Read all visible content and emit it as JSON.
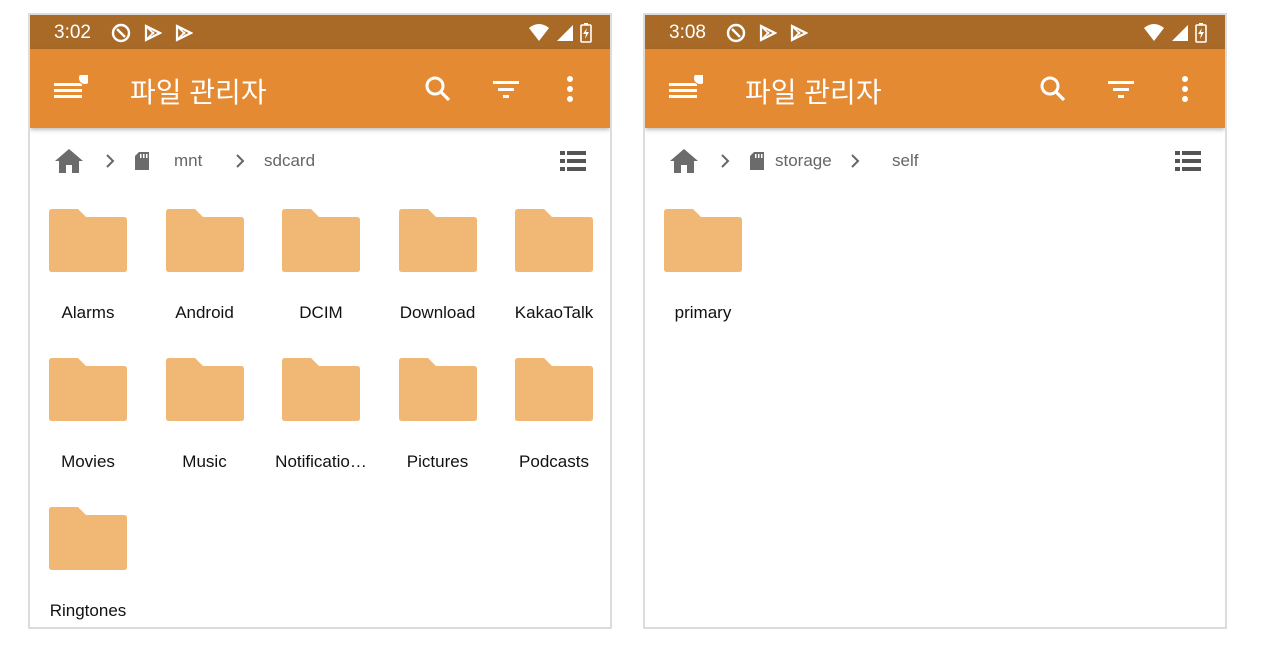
{
  "colors": {
    "status_bar": "#a96a28",
    "app_bar": "#e38a33",
    "folder": "#f0b775",
    "text": "#111111",
    "breadcrumb_text": "#666666"
  },
  "icons": {
    "status": [
      "do-not-disturb-icon",
      "play-store-icon",
      "play-store-icon",
      "wifi-icon",
      "signal-icon",
      "battery-charging-icon"
    ],
    "app_bar": [
      "menu-icon",
      "notification-dot",
      "search-icon",
      "filter-icon",
      "more-vert-icon"
    ],
    "breadcrumb": [
      "home-icon",
      "chevron-right-icon",
      "sd-card-icon"
    ],
    "view_toggle": "list-view-icon",
    "item": "folder-icon"
  },
  "left": {
    "status_time": "3:02",
    "app_title": "파일 관리자",
    "breadcrumb": [
      "mnt",
      "sdcard"
    ],
    "folders": [
      "Alarms",
      "Android",
      "DCIM",
      "Download",
      "KakaoTalk",
      "Movies",
      "Music",
      "Notificatio…",
      "Pictures",
      "Podcasts",
      "Ringtones"
    ]
  },
  "right": {
    "status_time": "3:08",
    "app_title": "파일 관리자",
    "breadcrumb": [
      "storage",
      "self"
    ],
    "folders": [
      "primary"
    ]
  }
}
